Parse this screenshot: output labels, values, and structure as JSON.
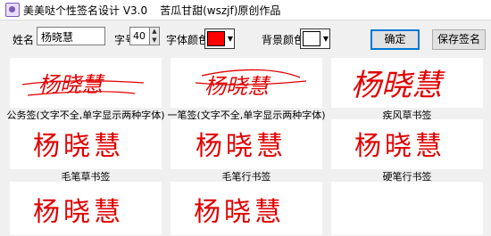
{
  "window": {
    "title": "美美哒个性签名设计 V3.0",
    "author": "苦瓜甘甜(wszjf)原创作品"
  },
  "toolbar": {
    "name_label": "姓名",
    "name_value": "杨晓慧",
    "size_label": "字号",
    "size_value": "40",
    "font_color_label": "字体颜色",
    "font_color": "#ff0000",
    "bg_color_label": "背景颜色",
    "bg_color": "#ffffff",
    "confirm_button": "确定",
    "save_button": "保存签名"
  },
  "signatures": [
    {
      "text": "杨晓慧",
      "caption": "公务签(文字不全,单字显示两种字体)"
    },
    {
      "text": "杨晓慧",
      "caption": "一笔签(文字不全,单字显示两种字体)"
    },
    {
      "text": "杨晓慧",
      "caption": "疾风草书签"
    },
    {
      "text": "杨晓慧",
      "caption": "毛笔草书签"
    },
    {
      "text": "杨晓慧",
      "caption": "毛笔行书签"
    },
    {
      "text": "杨晓慧",
      "caption": "硬笔行书签"
    },
    {
      "text": "杨晓慧",
      "caption": ""
    },
    {
      "text": "杨晓慧",
      "caption": ""
    },
    {
      "text": "",
      "caption": ""
    }
  ]
}
